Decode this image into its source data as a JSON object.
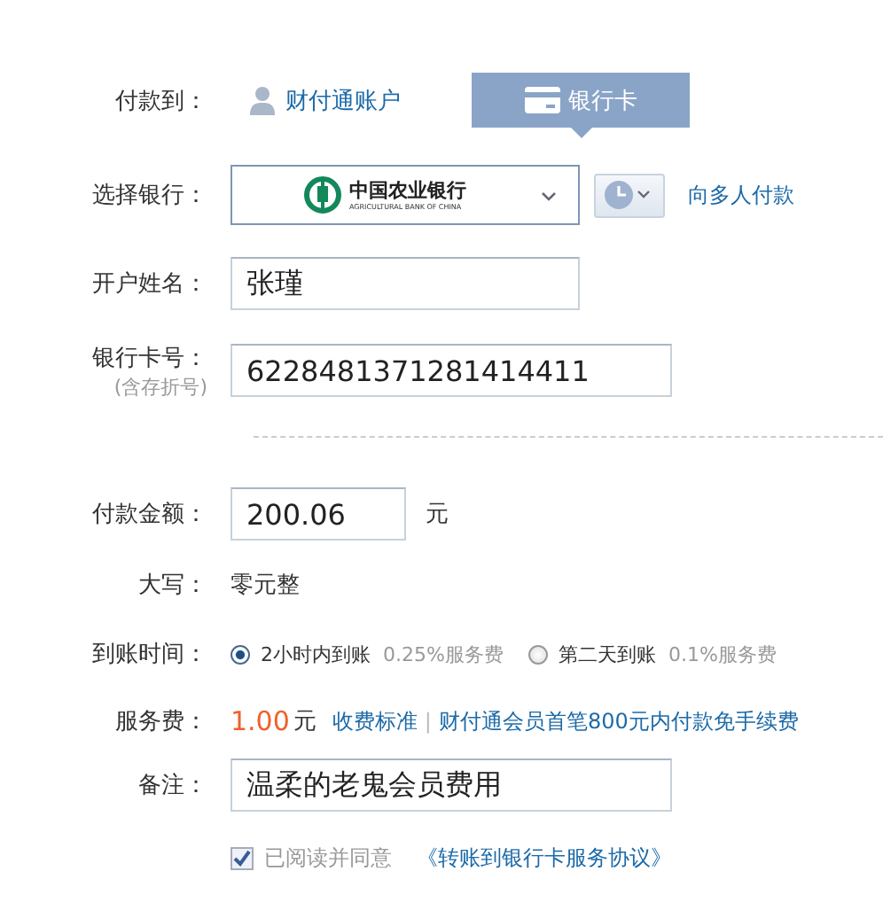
{
  "pay_to": {
    "label": "付款到：",
    "tabs": [
      {
        "label": "财付通账户",
        "kind": "account",
        "selected": false
      },
      {
        "label": "银行卡",
        "kind": "card",
        "selected": true
      }
    ]
  },
  "bank": {
    "label": "选择银行：",
    "name_cn": "中国农业银行",
    "name_en": "AGRICULTURAL BANK OF CHINA",
    "multi_link": "向多人付款"
  },
  "account_name": {
    "label": "开户姓名：",
    "value": "张瑾"
  },
  "card_number": {
    "label": "银行卡号：",
    "sublabel": "(含存折号)",
    "value": "6228481371281414411"
  },
  "amount": {
    "label": "付款金额：",
    "value": "200.06",
    "unit": "元"
  },
  "uppercase": {
    "label": "大写：",
    "value": "零元整"
  },
  "arrival": {
    "label": "到账时间：",
    "options": [
      {
        "label": "2小时内到账",
        "fee": "0.25%服务费",
        "selected": true
      },
      {
        "label": "第二天到账",
        "fee": "0.1%服务费",
        "selected": false
      }
    ]
  },
  "service_fee": {
    "label": "服务费：",
    "amount": "1.00",
    "unit": "元",
    "standard_link": "收费标准",
    "separator": "|",
    "promo_link": "财付通会员首笔800元内付款免手续费"
  },
  "note": {
    "label": "备注：",
    "value": "温柔的老鬼会员费用"
  },
  "agreement": {
    "checked": true,
    "text": "已阅读并同意",
    "link": "《转账到银行卡服务协议》"
  }
}
